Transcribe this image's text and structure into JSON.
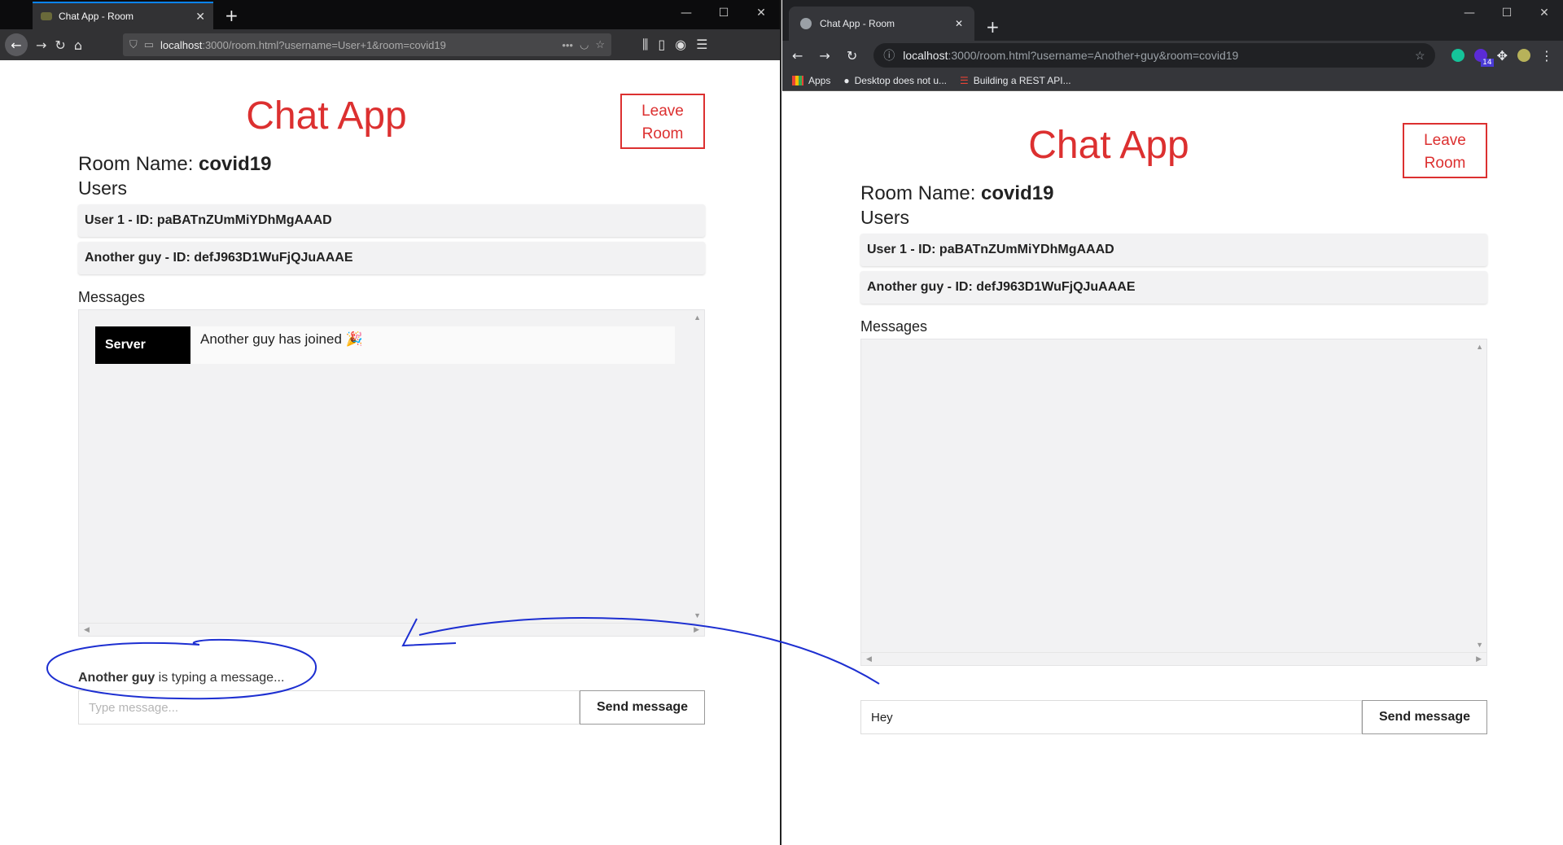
{
  "left_window": {
    "tab_title": "Chat App - Room",
    "url_host": "localhost",
    "url_rest": ":3000/room.html?username=User+1&room=covid19",
    "app": {
      "title": "Chat App",
      "leave_button": "Leave Room",
      "room_label": "Room Name: ",
      "room_name": "covid19",
      "users_label": "Users",
      "users": [
        "User 1 - ID: paBATnZUmMiYDhMgAAAD",
        "Another guy - ID: defJ963D1WuFjQJuAAAE"
      ],
      "messages_label": "Messages",
      "messages": [
        {
          "sender": "Server",
          "text": "Another guy has joined 🎉"
        }
      ],
      "typing_user": "Another guy",
      "typing_text": " is typing a message...",
      "input_value": "",
      "input_placeholder": "Type message...",
      "send_button": "Send message"
    }
  },
  "right_window": {
    "tab_title": "Chat App - Room",
    "url_host": "localhost",
    "url_rest": ":3000/room.html?username=Another+guy&room=covid19",
    "bookmarks": [
      "Apps",
      "Desktop does not u...",
      "Building a REST API..."
    ],
    "extension_badge": "14",
    "app": {
      "title": "Chat App",
      "leave_button": "Leave Room",
      "room_label": "Room Name: ",
      "room_name": "covid19",
      "users_label": "Users",
      "users": [
        "User 1 - ID: paBATnZUmMiYDhMgAAAD",
        "Another guy - ID: defJ963D1WuFjQJuAAAE"
      ],
      "messages_label": "Messages",
      "messages": [],
      "input_value": "Hey",
      "send_button": "Send message"
    }
  },
  "colors": {
    "accent_red": "#dc3030",
    "annotation_blue": "#1d2fd1",
    "sender_bg": "#000000"
  }
}
